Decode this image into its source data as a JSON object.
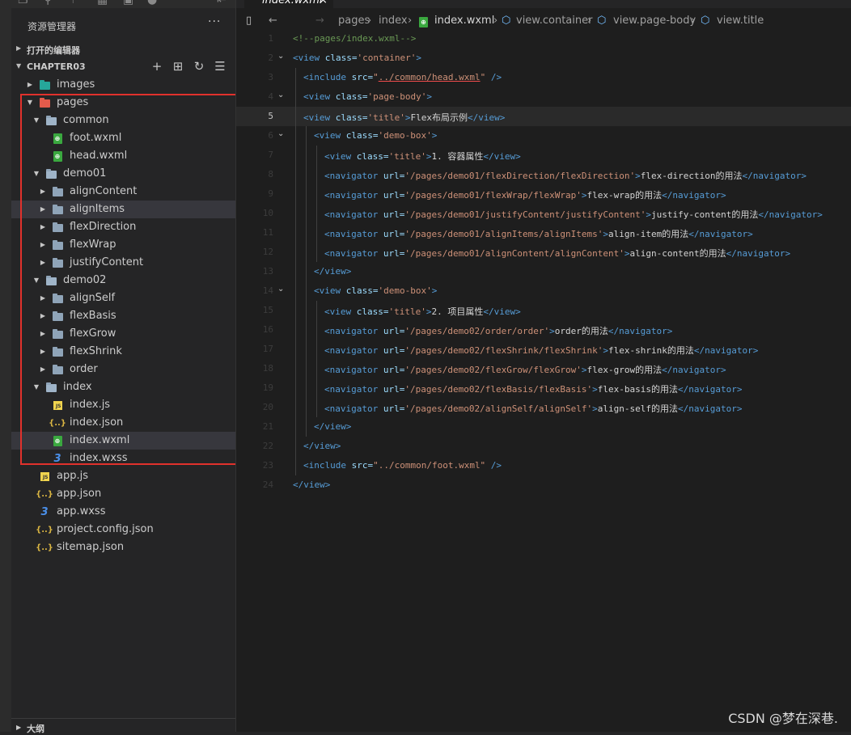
{
  "activity_icons": [
    "files-icon",
    "search-icon",
    "source-control-icon",
    "extensions-icon",
    "debug-icon",
    "cloud-icon",
    "split-icon"
  ],
  "sidebar": {
    "title": "资源管理器",
    "more_label": "···",
    "open_editors_label": "打开的编辑器",
    "project_label": "CHAPTER03",
    "project_actions": [
      "new-file-icon",
      "new-folder-icon",
      "refresh-icon",
      "collapse-icon"
    ],
    "tree": [
      {
        "name": "images",
        "kind": "folder-img",
        "depth": 0,
        "twisty": "collapsed"
      },
      {
        "name": "pages",
        "kind": "folder-red",
        "depth": 0,
        "twisty": "expanded"
      },
      {
        "name": "common",
        "kind": "folder",
        "depth": 1,
        "twisty": "expanded"
      },
      {
        "name": "foot.wxml",
        "kind": "wxml",
        "depth": 2,
        "twisty": "none"
      },
      {
        "name": "head.wxml",
        "kind": "wxml",
        "depth": 2,
        "twisty": "none"
      },
      {
        "name": "demo01",
        "kind": "folder",
        "depth": 1,
        "twisty": "expanded"
      },
      {
        "name": "alignContent",
        "kind": "folder",
        "depth": 2,
        "twisty": "collapsed"
      },
      {
        "name": "alignItems",
        "kind": "folder",
        "depth": 2,
        "twisty": "collapsed",
        "hover": true
      },
      {
        "name": "flexDirection",
        "kind": "folder",
        "depth": 2,
        "twisty": "collapsed"
      },
      {
        "name": "flexWrap",
        "kind": "folder",
        "depth": 2,
        "twisty": "collapsed"
      },
      {
        "name": "justifyContent",
        "kind": "folder",
        "depth": 2,
        "twisty": "collapsed"
      },
      {
        "name": "demo02",
        "kind": "folder",
        "depth": 1,
        "twisty": "expanded"
      },
      {
        "name": "alignSelf",
        "kind": "folder",
        "depth": 2,
        "twisty": "collapsed"
      },
      {
        "name": "flexBasis",
        "kind": "folder",
        "depth": 2,
        "twisty": "collapsed"
      },
      {
        "name": "flexGrow",
        "kind": "folder",
        "depth": 2,
        "twisty": "collapsed"
      },
      {
        "name": "flexShrink",
        "kind": "folder",
        "depth": 2,
        "twisty": "collapsed"
      },
      {
        "name": "order",
        "kind": "folder",
        "depth": 2,
        "twisty": "collapsed"
      },
      {
        "name": "index",
        "kind": "folder",
        "depth": 1,
        "twisty": "expanded"
      },
      {
        "name": "index.js",
        "kind": "js",
        "depth": 2,
        "twisty": "none"
      },
      {
        "name": "index.json",
        "kind": "json",
        "depth": 2,
        "twisty": "none"
      },
      {
        "name": "index.wxml",
        "kind": "wxml",
        "depth": 2,
        "twisty": "none",
        "selected": true
      },
      {
        "name": "index.wxss",
        "kind": "wxss",
        "depth": 2,
        "twisty": "none"
      },
      {
        "name": "app.js",
        "kind": "js",
        "depth": 0,
        "twisty": "none"
      },
      {
        "name": "app.json",
        "kind": "json",
        "depth": 0,
        "twisty": "none"
      },
      {
        "name": "app.wxss",
        "kind": "wxss",
        "depth": 0,
        "twisty": "none"
      },
      {
        "name": "project.config.json",
        "kind": "json",
        "depth": 0,
        "twisty": "none"
      },
      {
        "name": "sitemap.json",
        "kind": "json",
        "depth": 0,
        "twisty": "none"
      }
    ],
    "outline_label": "大纲"
  },
  "editor": {
    "tab_title": "index.wxml",
    "tab_close": "×",
    "breadcrumb": [
      "pages",
      "index",
      "index.wxml",
      "view.container",
      "view.page-body",
      "view.title"
    ],
    "current_line": 5,
    "lines": [
      {
        "n": 1,
        "indent": 0,
        "fold": false,
        "tokens": [
          [
            "c",
            "<!--pages/index.wxml-->"
          ]
        ]
      },
      {
        "n": 2,
        "indent": 0,
        "fold": true,
        "tokens": [
          [
            "t",
            "<view "
          ],
          [
            "a",
            "class="
          ],
          [
            "v",
            "'container'"
          ],
          [
            "t",
            ">"
          ]
        ]
      },
      {
        "n": 3,
        "indent": 1,
        "fold": false,
        "tokens": [
          [
            "t",
            "<include "
          ],
          [
            "a",
            "src="
          ],
          [
            "v",
            "\""
          ],
          [
            "vu",
            "../common/head.wxml"
          ],
          [
            "v",
            "\""
          ],
          [
            "t",
            " />"
          ]
        ]
      },
      {
        "n": 4,
        "indent": 1,
        "fold": true,
        "tokens": [
          [
            "t",
            "<view "
          ],
          [
            "a",
            "class="
          ],
          [
            "v",
            "'page-body'"
          ],
          [
            "t",
            ">"
          ]
        ]
      },
      {
        "n": 5,
        "indent": 1,
        "fold": false,
        "tokens": [
          [
            "t",
            "<view "
          ],
          [
            "a",
            "class="
          ],
          [
            "v",
            "'title'"
          ],
          [
            "t",
            ">"
          ],
          [
            "x",
            "Flex布局示例"
          ],
          [
            "t",
            "</view>"
          ]
        ]
      },
      {
        "n": 6,
        "indent": 2,
        "fold": true,
        "tokens": [
          [
            "t",
            "<view "
          ],
          [
            "a",
            "class="
          ],
          [
            "v",
            "'demo-box'"
          ],
          [
            "t",
            ">"
          ]
        ]
      },
      {
        "n": 7,
        "indent": 3,
        "fold": false,
        "tokens": [
          [
            "t",
            "<view "
          ],
          [
            "a",
            "class="
          ],
          [
            "v",
            "'title'"
          ],
          [
            "t",
            ">"
          ],
          [
            "x",
            "1. 容器属性"
          ],
          [
            "t",
            "</view>"
          ]
        ]
      },
      {
        "n": 8,
        "indent": 3,
        "fold": false,
        "tokens": [
          [
            "t",
            "<navigator "
          ],
          [
            "a",
            "url="
          ],
          [
            "v",
            "'/pages/demo01/flexDirection/flexDirection'"
          ],
          [
            "t",
            ">"
          ],
          [
            "x",
            "flex-direction的用法"
          ],
          [
            "t",
            "</navigator>"
          ]
        ]
      },
      {
        "n": 9,
        "indent": 3,
        "fold": false,
        "tokens": [
          [
            "t",
            "<navigator "
          ],
          [
            "a",
            "url="
          ],
          [
            "v",
            "'/pages/demo01/flexWrap/flexWrap'"
          ],
          [
            "t",
            ">"
          ],
          [
            "x",
            "flex-wrap的用法"
          ],
          [
            "t",
            "</navigator>"
          ]
        ]
      },
      {
        "n": 10,
        "indent": 3,
        "fold": false,
        "tokens": [
          [
            "t",
            "<navigator "
          ],
          [
            "a",
            "url="
          ],
          [
            "v",
            "'/pages/demo01/justifyContent/justifyContent'"
          ],
          [
            "t",
            ">"
          ],
          [
            "x",
            "justify-content的用法"
          ],
          [
            "t",
            "</navigator>"
          ]
        ]
      },
      {
        "n": 11,
        "indent": 3,
        "fold": false,
        "tokens": [
          [
            "t",
            "<navigator "
          ],
          [
            "a",
            "url="
          ],
          [
            "v",
            "'/pages/demo01/alignItems/alignItems'"
          ],
          [
            "t",
            ">"
          ],
          [
            "x",
            "align-item的用法"
          ],
          [
            "t",
            "</navigator>"
          ]
        ]
      },
      {
        "n": 12,
        "indent": 3,
        "fold": false,
        "tokens": [
          [
            "t",
            "<navigator "
          ],
          [
            "a",
            "url="
          ],
          [
            "v",
            "'/pages/demo01/alignContent/alignContent'"
          ],
          [
            "t",
            ">"
          ],
          [
            "x",
            "align-content的用法"
          ],
          [
            "t",
            "</navigator>"
          ]
        ]
      },
      {
        "n": 13,
        "indent": 2,
        "fold": false,
        "tokens": [
          [
            "t",
            "</view>"
          ]
        ]
      },
      {
        "n": 14,
        "indent": 2,
        "fold": true,
        "tokens": [
          [
            "t",
            "<view "
          ],
          [
            "a",
            "class="
          ],
          [
            "v",
            "'demo-box'"
          ],
          [
            "t",
            ">"
          ]
        ]
      },
      {
        "n": 15,
        "indent": 3,
        "fold": false,
        "tokens": [
          [
            "t",
            "<view "
          ],
          [
            "a",
            "class="
          ],
          [
            "v",
            "'title'"
          ],
          [
            "t",
            ">"
          ],
          [
            "x",
            "2. 项目属性"
          ],
          [
            "t",
            "</view>"
          ]
        ]
      },
      {
        "n": 16,
        "indent": 3,
        "fold": false,
        "tokens": [
          [
            "t",
            "<navigator "
          ],
          [
            "a",
            "url="
          ],
          [
            "v",
            "'/pages/demo02/order/order'"
          ],
          [
            "t",
            ">"
          ],
          [
            "x",
            "order的用法"
          ],
          [
            "t",
            "</navigator>"
          ]
        ]
      },
      {
        "n": 17,
        "indent": 3,
        "fold": false,
        "tokens": [
          [
            "t",
            "<navigator "
          ],
          [
            "a",
            "url="
          ],
          [
            "v",
            "'/pages/demo02/flexShrink/flexShrink'"
          ],
          [
            "t",
            ">"
          ],
          [
            "x",
            "flex-shrink的用法"
          ],
          [
            "t",
            "</navigator>"
          ]
        ]
      },
      {
        "n": 18,
        "indent": 3,
        "fold": false,
        "tokens": [
          [
            "t",
            "<navigator "
          ],
          [
            "a",
            "url="
          ],
          [
            "v",
            "'/pages/demo02/flexGrow/flexGrow'"
          ],
          [
            "t",
            ">"
          ],
          [
            "x",
            "flex-grow的用法"
          ],
          [
            "t",
            "</navigator>"
          ]
        ]
      },
      {
        "n": 19,
        "indent": 3,
        "fold": false,
        "tokens": [
          [
            "t",
            "<navigator "
          ],
          [
            "a",
            "url="
          ],
          [
            "v",
            "'/pages/demo02/flexBasis/flexBasis'"
          ],
          [
            "t",
            ">"
          ],
          [
            "x",
            "flex-basis的用法"
          ],
          [
            "t",
            "</navigator>"
          ]
        ]
      },
      {
        "n": 20,
        "indent": 3,
        "fold": false,
        "tokens": [
          [
            "t",
            "<navigator "
          ],
          [
            "a",
            "url="
          ],
          [
            "v",
            "'/pages/demo02/alignSelf/alignSelf'"
          ],
          [
            "t",
            ">"
          ],
          [
            "x",
            "align-self的用法"
          ],
          [
            "t",
            "</navigator>"
          ]
        ]
      },
      {
        "n": 21,
        "indent": 2,
        "fold": false,
        "tokens": [
          [
            "t",
            "</view>"
          ]
        ]
      },
      {
        "n": 22,
        "indent": 1,
        "fold": false,
        "tokens": [
          [
            "t",
            "</view>"
          ]
        ]
      },
      {
        "n": 23,
        "indent": 1,
        "fold": false,
        "tokens": [
          [
            "t",
            "<include "
          ],
          [
            "a",
            "src="
          ],
          [
            "v",
            "\"../common/foot.wxml\""
          ],
          [
            "t",
            " />"
          ]
        ]
      },
      {
        "n": 24,
        "indent": 0,
        "fold": false,
        "tokens": [
          [
            "t",
            "</view>"
          ]
        ]
      }
    ]
  },
  "colors": {
    "highlight_border": "#e1312c",
    "tag": "#569cd6",
    "attr": "#9cdcfe",
    "string": "#ce9178",
    "comment": "#6a9955"
  },
  "watermark": "CSDN @梦在深巷."
}
